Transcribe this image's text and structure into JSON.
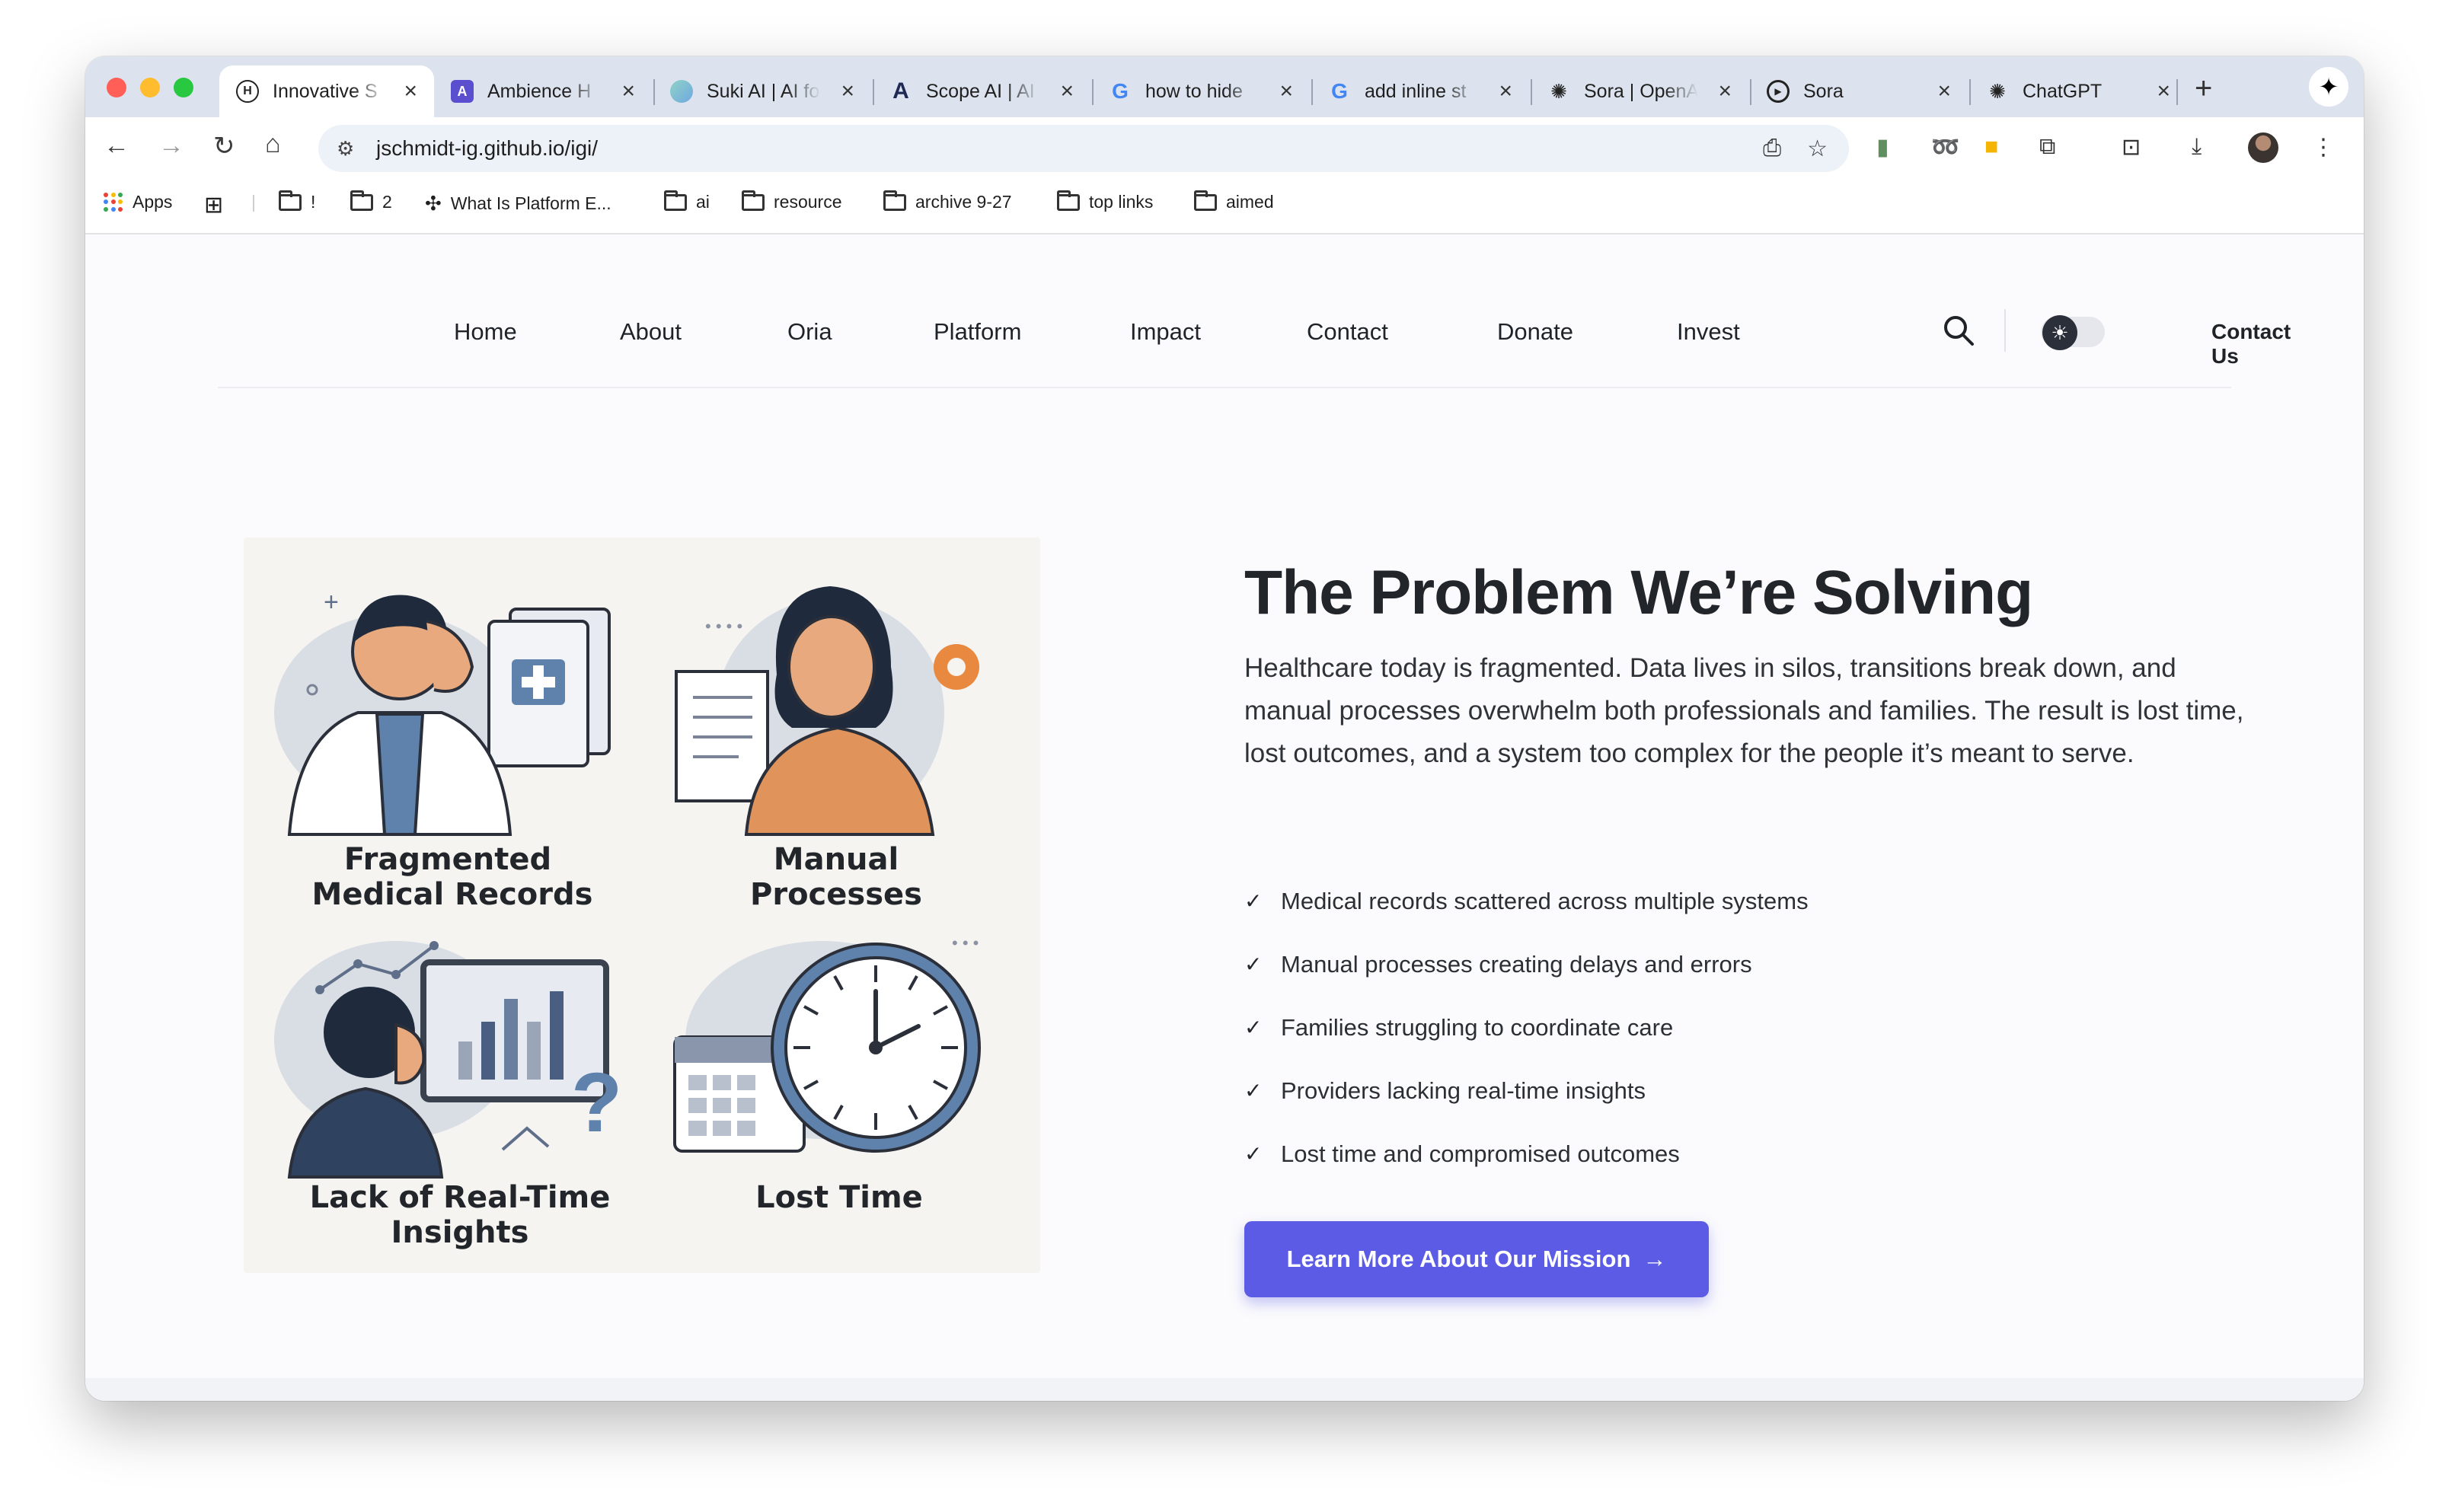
{
  "browser": {
    "tabs": [
      {
        "title": "Innovative S",
        "favicon": "H",
        "active": true
      },
      {
        "title": "Ambience H",
        "favicon": "A"
      },
      {
        "title": "Suki AI | AI fo",
        "favicon": "S"
      },
      {
        "title": "Scope AI | AI",
        "favicon": "A"
      },
      {
        "title": "how to hide",
        "favicon": "G"
      },
      {
        "title": "add inline st",
        "favicon": "G"
      },
      {
        "title": "Sora | OpenA",
        "favicon": "openai"
      },
      {
        "title": "Sora",
        "favicon": "play"
      },
      {
        "title": "ChatGPT",
        "favicon": "openai"
      }
    ],
    "url": "jschmidt-ig.github.io/igi/",
    "bookmarks": [
      {
        "label": "Apps",
        "icon": "apps-grid-icon"
      },
      {
        "label": "",
        "icon": "tab-groups-icon"
      },
      {
        "label": "!",
        "icon": "folder-icon"
      },
      {
        "label": "2",
        "icon": "folder-icon"
      },
      {
        "label": "What Is Platform E...",
        "icon": "slack-icon"
      },
      {
        "label": "ai",
        "icon": "folder-icon"
      },
      {
        "label": "resource",
        "icon": "folder-icon"
      },
      {
        "label": "archive 9-27",
        "icon": "folder-icon"
      },
      {
        "label": "top links",
        "icon": "folder-icon"
      },
      {
        "label": "aimed",
        "icon": "folder-icon"
      }
    ]
  },
  "site": {
    "nav": [
      "Home",
      "About",
      "Oria",
      "Platform",
      "Impact",
      "Contact",
      "Donate",
      "Invest"
    ],
    "contact_us": "Contact Us",
    "accent": "#5b5be6"
  },
  "hero": {
    "heading": "The Problem We’re Solving",
    "paragraph": "Healthcare today is fragmented. Data lives in silos, transitions break down, and manual processes overwhelm both professionals and families. The result is lost time, lost outcomes, and a system too complex for the people it’s meant to serve.",
    "checklist": [
      "Medical records scattered across multiple systems",
      "Manual processes creating delays and errors",
      "Families struggling to coordinate care",
      "Providers lacking real-time insights",
      "Lost time and compromised outcomes"
    ],
    "cta": "Learn More About Our Mission",
    "illustration": {
      "captions": [
        [
          "Fragmented",
          "Medical Records"
        ],
        [
          "Manual",
          "Processes"
        ],
        [
          "Lack of Real-Time",
          "Insights"
        ],
        [
          "Lost Time"
        ]
      ]
    }
  }
}
